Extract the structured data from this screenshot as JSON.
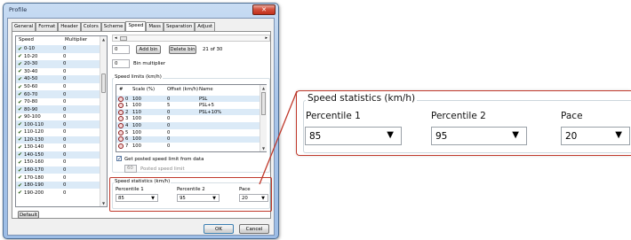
{
  "window": {
    "title": "Profile",
    "close_glyph": "✕"
  },
  "tabs": [
    "General",
    "Format",
    "Header",
    "Colors",
    "Scheme",
    "Speed",
    "Mass",
    "Separation",
    "Adjust"
  ],
  "active_tab": "Speed",
  "speed_list": {
    "header_speed": "Speed",
    "header_multiplier": "Multiplier",
    "rows": [
      {
        "range": "0-10",
        "multiplier": "0"
      },
      {
        "range": "10-20",
        "multiplier": "0"
      },
      {
        "range": "20-30",
        "multiplier": "0"
      },
      {
        "range": "30-40",
        "multiplier": "0"
      },
      {
        "range": "40-50",
        "multiplier": "0"
      },
      {
        "range": "50-60",
        "multiplier": "0"
      },
      {
        "range": "60-70",
        "multiplier": "0"
      },
      {
        "range": "70-80",
        "multiplier": "0"
      },
      {
        "range": "80-90",
        "multiplier": "0"
      },
      {
        "range": "90-100",
        "multiplier": "0"
      },
      {
        "range": "100-110",
        "multiplier": "0"
      },
      {
        "range": "110-120",
        "multiplier": "0"
      },
      {
        "range": "120-130",
        "multiplier": "0"
      },
      {
        "range": "130-140",
        "multiplier": "0"
      },
      {
        "range": "140-150",
        "multiplier": "0"
      },
      {
        "range": "150-160",
        "multiplier": "0"
      },
      {
        "range": "160-170",
        "multiplier": "0"
      },
      {
        "range": "170-180",
        "multiplier": "0"
      },
      {
        "range": "180-190",
        "multiplier": "0"
      },
      {
        "range": "190-200",
        "multiplier": "0"
      }
    ]
  },
  "default_button": "Default",
  "bins": {
    "bin_value": "0",
    "add_bin": "Add bin",
    "delete_bin": "Delete bin",
    "count": "21 of 30",
    "bin_multiplier_value": "0",
    "bin_multiplier_label": "Bin multiplier"
  },
  "speed_limits": {
    "title": "Speed limits (km/h)",
    "headers": [
      "#",
      "Scale (%)",
      "Offset (km/h)",
      "Name"
    ],
    "rows": [
      {
        "num": "0",
        "scale": "100",
        "offset": "0",
        "name": "PSL"
      },
      {
        "num": "1",
        "scale": "100",
        "offset": "5",
        "name": "PSL+5"
      },
      {
        "num": "2",
        "scale": "110",
        "offset": "0",
        "name": "PSL+10%"
      },
      {
        "num": "3",
        "scale": "100",
        "offset": "0",
        "name": ""
      },
      {
        "num": "4",
        "scale": "100",
        "offset": "0",
        "name": ""
      },
      {
        "num": "5",
        "scale": "100",
        "offset": "0",
        "name": ""
      },
      {
        "num": "6",
        "scale": "100",
        "offset": "0",
        "name": ""
      },
      {
        "num": "7",
        "scale": "100",
        "offset": "0",
        "name": ""
      }
    ],
    "get_posted_label": "Get posted speed limit from data",
    "posted_value": "60",
    "posted_label": "Posted speed limit"
  },
  "speed_statistics": {
    "title": "Speed statistics (km/h)",
    "percentile1_label": "Percentile 1",
    "percentile1_value": "85",
    "percentile2_label": "Percentile 2",
    "percentile2_value": "95",
    "pace_label": "Pace",
    "pace_value": "20"
  },
  "buttons": {
    "ok": "OK",
    "cancel": "Cancel"
  },
  "colors": {
    "callout": "#c0392b",
    "list_alt_row": "#dbeaf7"
  }
}
